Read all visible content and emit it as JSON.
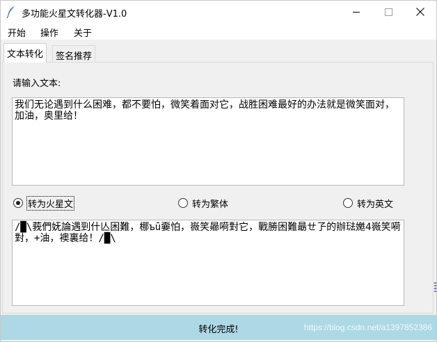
{
  "window": {
    "title": "多功能火星文转化器-V1.0",
    "icon": "feather-icon"
  },
  "menu": {
    "items": [
      "开始",
      "操作",
      "关于"
    ]
  },
  "tabs": [
    {
      "label": "文本转化",
      "active": true
    },
    {
      "label": "签名推荐",
      "active": false
    }
  ],
  "input": {
    "label": "请输入文本:",
    "text": "我们无论遇到什么困难，都不要怕，微笑着面对它，战胜困难最好的办法就是微笑面对，加油，奥里给！"
  },
  "options": [
    {
      "label": "转为火星文",
      "checked": true
    },
    {
      "label": "转为繁体",
      "checked": false
    },
    {
      "label": "转为英文",
      "checked": false
    }
  ],
  "output": {
    "text": "/█\\莪們妩論遇剄什亾困難，梛ъū嫑怕，嶶笑曏嗬對它，戰勝困難朂ㄝ孒的辦琺嬔4嶶笑嗬對，+油，襖裏给！/█\\"
  },
  "status": {
    "text": "转化完成!",
    "watermark": "https://blog.csdn.net/a1397852386"
  },
  "colors": {
    "status_bar": "#add8e6",
    "panel_bg": "#f0f0f0"
  }
}
